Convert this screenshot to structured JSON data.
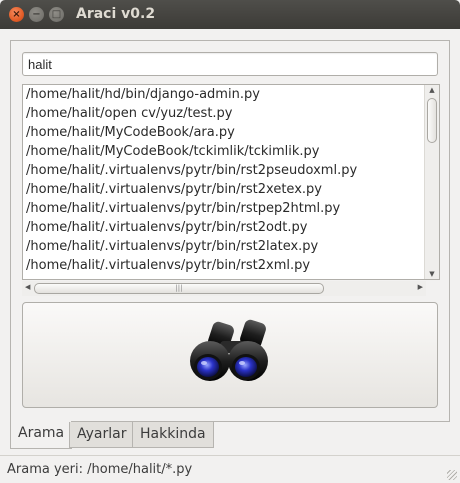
{
  "window": {
    "title": "Araci v0.2",
    "controls": {
      "close": "×",
      "minimize": "−",
      "maximize": "□"
    }
  },
  "search": {
    "value": "halit",
    "icon": "binoculars-icon"
  },
  "results": [
    "/home/halit/hd/bin/django-admin.py",
    "/home/halit/open cv/yuz/test.py",
    "/home/halit/MyCodeBook/ara.py",
    "/home/halit/MyCodeBook/tckimlik/tckimlik.py",
    "/home/halit/.virtualenvs/pytr/bin/rst2pseudoxml.py",
    "/home/halit/.virtualenvs/pytr/bin/rst2xetex.py",
    "/home/halit/.virtualenvs/pytr/bin/rstpep2html.py",
    "/home/halit/.virtualenvs/pytr/bin/rst2odt.py",
    "/home/halit/.virtualenvs/pytr/bin/rst2latex.py",
    "/home/halit/.virtualenvs/pytr/bin/rst2xml.py"
  ],
  "tabs": [
    {
      "label": "Arama",
      "active": true
    },
    {
      "label": "Ayarlar",
      "active": false
    },
    {
      "label": "Hakkinda",
      "active": false
    }
  ],
  "status": {
    "text": "Arama yeri: /home/halit/*.py"
  },
  "colors": {
    "titlebar": "#3c3b37",
    "close_button": "#e35d27",
    "window_bg": "#f2f1f0"
  }
}
